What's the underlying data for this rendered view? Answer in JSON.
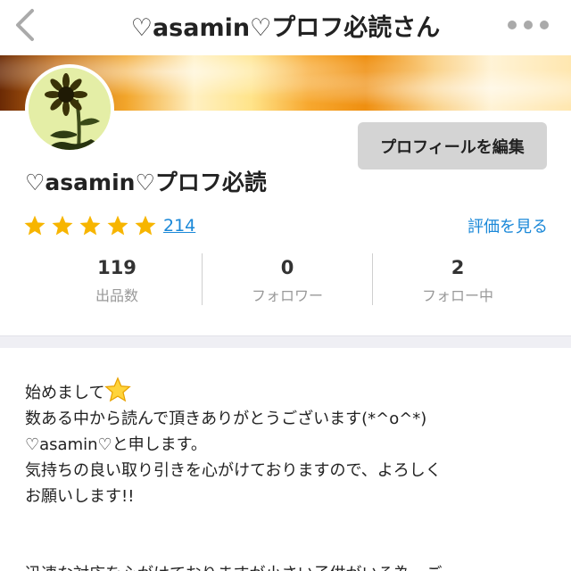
{
  "header": {
    "title": "♡asamin♡プロフ必読さん"
  },
  "profile": {
    "edit_button_label": "プロフィールを編集",
    "name": "♡asamin♡プロフ必読",
    "rating": {
      "stars": 5,
      "review_count": "214",
      "view_ratings_label": "評価を見る"
    }
  },
  "stats": [
    {
      "value": "119",
      "label": "出品数"
    },
    {
      "value": "0",
      "label": "フォロワー"
    },
    {
      "value": "2",
      "label": "フォロー中"
    }
  ],
  "bio": {
    "line1": "始めまして",
    "line2": "数ある中から読んで頂きありがとうございます(*^o^*)",
    "line3": "♡asamin♡と申します。",
    "line4": "気持ちの良い取り引きを心がけておりますので、よろしく",
    "line5": "お願いします!!",
    "line6": "迅速な対応を心がけておりますが小さい子供がいる為、ご"
  },
  "icons": {
    "back": "chevron-left-icon",
    "more": "ellipsis-icon",
    "rating_star": "star-icon",
    "bio_star": "star-emoji-icon"
  },
  "colors": {
    "link": "#1a88d8",
    "star": "#f7b500",
    "button_bg": "#d4d4d4",
    "band": "#efeff4"
  }
}
